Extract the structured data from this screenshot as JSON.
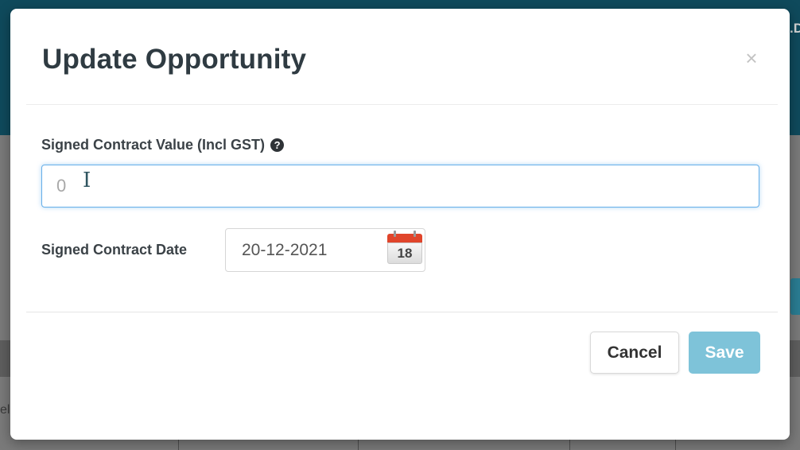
{
  "background": {
    "right_text": ".D",
    "left_text": "el"
  },
  "modal": {
    "title": "Update Opportunity",
    "close_glyph": "×",
    "contract_value": {
      "label": "Signed Contract Value (Incl GST)",
      "help_glyph": "?",
      "placeholder": "0",
      "value": ""
    },
    "contract_date": {
      "label": "Signed Contract Date",
      "value": "20-12-2021",
      "calendar_day": "18"
    },
    "buttons": {
      "cancel": "Cancel",
      "save": "Save"
    }
  },
  "icons": {
    "close": "close-icon",
    "help": "question-circle-icon",
    "calendar": "calendar-icon",
    "cursor": "text-cursor-icon"
  },
  "colors": {
    "header_bg": "#0f4a5c",
    "save_button": "#7ec3d9",
    "input_focus": "#66afe9",
    "calendar_red": "#e0452b"
  }
}
